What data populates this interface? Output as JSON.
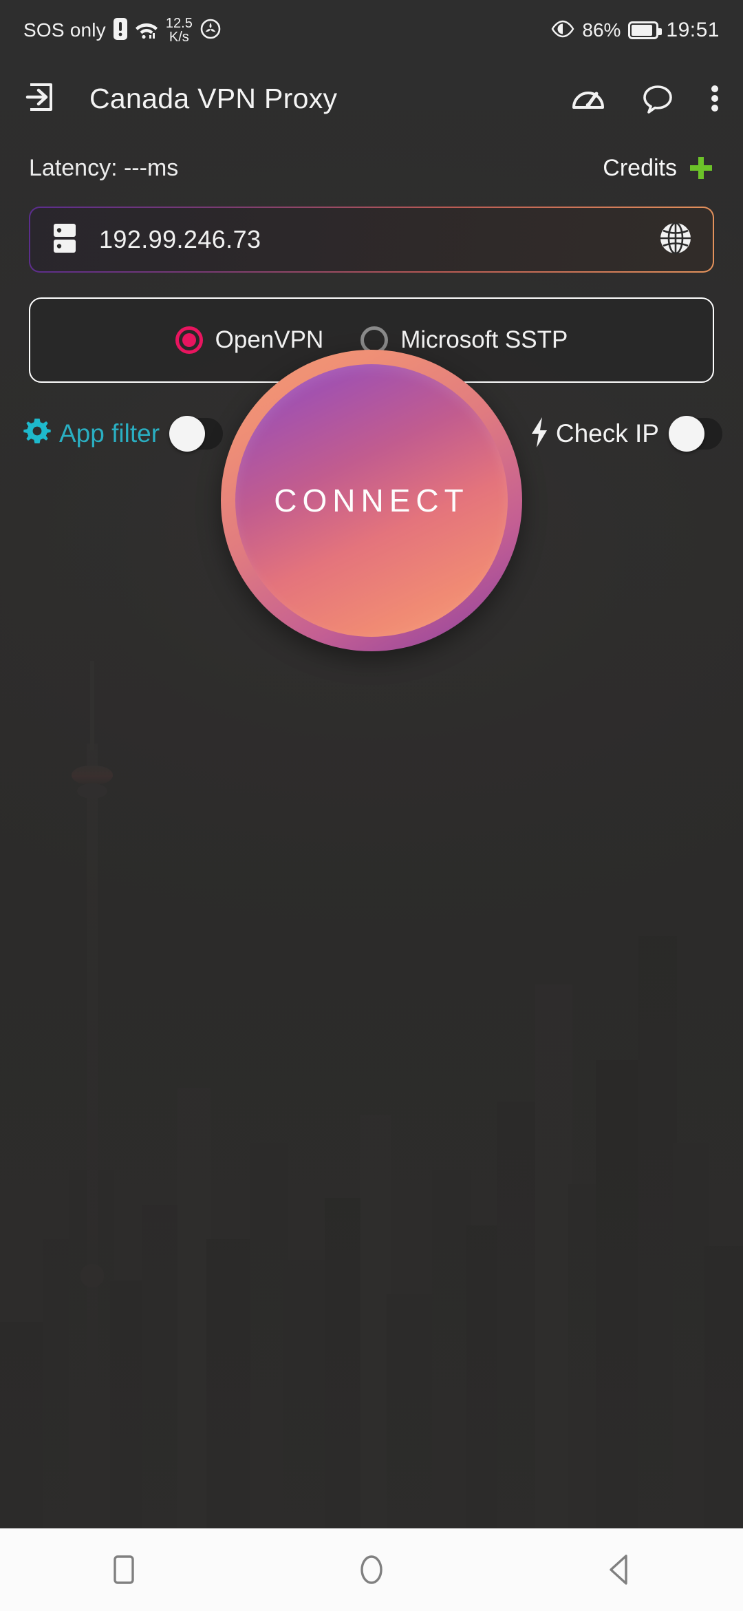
{
  "status_bar": {
    "carrier": "SOS only",
    "sim_alert_icon": "sim-alert-icon",
    "wifi_icon": "wifi-icon",
    "net_speed_value": "12.5",
    "net_speed_unit": "K/s",
    "vpn_key_icon": "vpn-active-icon",
    "eye_icon": "eye-comfort-icon",
    "battery_percent": "86%",
    "battery_icon": "battery-icon",
    "clock": "19:51"
  },
  "app_bar": {
    "nav_icon": "login-arrow-icon",
    "title": "Canada VPN Proxy",
    "actions": [
      {
        "name": "speed-test-icon",
        "label": "speedometer"
      },
      {
        "name": "chat-icon",
        "label": "chat bubble"
      },
      {
        "name": "overflow-menu-icon",
        "label": "more options"
      }
    ]
  },
  "meta": {
    "latency": "Latency: ---ms",
    "credits_label": "Credits",
    "credits_plus_icon": "plus-icon",
    "plus_color": "#6cc229"
  },
  "server": {
    "rack_icon": "server-rack-icon",
    "ip": "192.99.246.73",
    "globe_icon": "globe-icon",
    "border_gradient_from": "#5b2d8e",
    "border_gradient_to": "#e4935c"
  },
  "protocol": {
    "options": [
      {
        "label": "OpenVPN",
        "selected": true
      },
      {
        "label": "Microsoft SSTP",
        "selected": false
      }
    ],
    "selected_color": "#e8155f",
    "unselected_color": "#8a8a8a"
  },
  "toggles": [
    {
      "label": "App filter",
      "icon": "gear-icon",
      "on": false,
      "color": "#2aafc2"
    },
    {
      "label": "Check IP",
      "icon": "lightning-bolt-icon",
      "on": false,
      "color": "#f3f3f3"
    }
  ],
  "connect": {
    "label": "CONNECT",
    "gradient_from": "#9c4bbd",
    "gradient_to": "#f6a179",
    "ring_color": "#f29a72"
  },
  "nav_bar": {
    "buttons": [
      {
        "name": "recents-button",
        "icon": "square-icon"
      },
      {
        "name": "home-button",
        "icon": "circle-icon"
      },
      {
        "name": "back-button",
        "icon": "triangle-left-icon"
      }
    ],
    "icon_color": "#808080"
  }
}
